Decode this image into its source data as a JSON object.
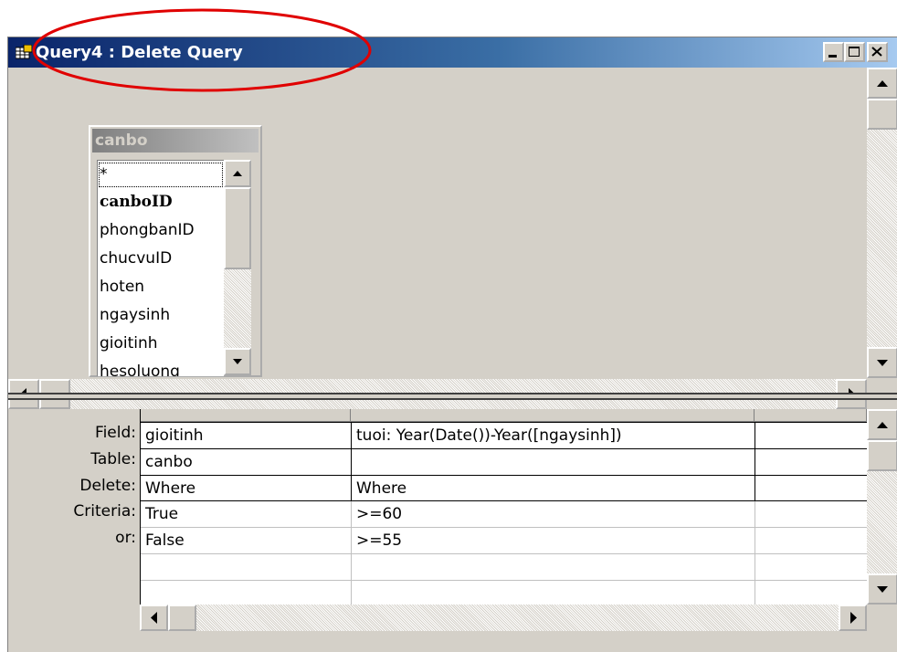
{
  "window": {
    "title": "Query4 : Delete Query",
    "minimize_icon": "minimize-icon",
    "maximize_icon": "maximize-icon",
    "close_icon": "close-icon",
    "title_icon": "query-icon",
    "annotation_color": "#e00000"
  },
  "field_list": {
    "table_name": "canbo",
    "fields": [
      "*",
      "canboID",
      "phongbanID",
      "chucvuID",
      "hoten",
      "ngaysinh",
      "gioitinh",
      "hesoluong"
    ],
    "primary_key": "canboID"
  },
  "design_grid": {
    "row_labels": [
      "Field:",
      "Table:",
      "Delete:",
      "Criteria:",
      "or:"
    ],
    "columns": [
      {
        "field": "gioitinh",
        "table": "canbo",
        "delete": "Where",
        "criteria": "True",
        "or": "False"
      },
      {
        "field": "tuoi: Year(Date())-Year([ngaysinh])",
        "table": "",
        "delete": "Where",
        "criteria": ">=60",
        "or": ">=55"
      },
      {
        "field": "",
        "table": "",
        "delete": "",
        "criteria": "",
        "or": ""
      }
    ]
  }
}
